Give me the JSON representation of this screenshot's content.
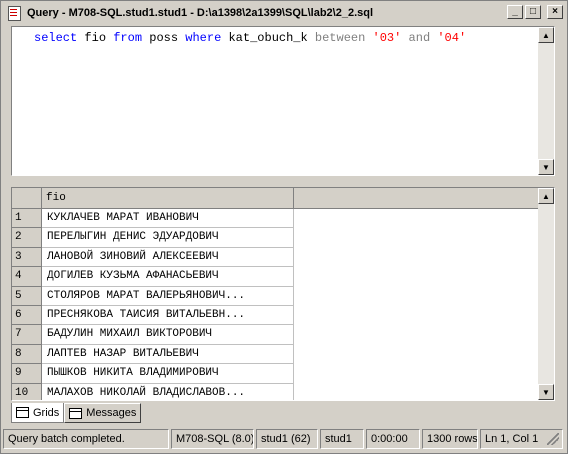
{
  "window": {
    "title": "Query - M708-SQL.stud1.stud1 - D:\\a1398\\2a1399\\SQL\\lab2\\2_2.sql",
    "minimize_label": "_",
    "maximize_label": "□",
    "close_label": "×"
  },
  "editor": {
    "tokens": [
      {
        "text": "select",
        "cls": "kw"
      },
      {
        "text": " fio ",
        "cls": ""
      },
      {
        "text": "from",
        "cls": "kw"
      },
      {
        "text": " poss ",
        "cls": ""
      },
      {
        "text": "where",
        "cls": "kw"
      },
      {
        "text": " kat_obuch_k ",
        "cls": ""
      },
      {
        "text": "between",
        "cls": "gr"
      },
      {
        "text": " ",
        "cls": ""
      },
      {
        "text": "'03'",
        "cls": "str"
      },
      {
        "text": " ",
        "cls": ""
      },
      {
        "text": "and",
        "cls": "gr"
      },
      {
        "text": " ",
        "cls": ""
      },
      {
        "text": "'04'",
        "cls": "str"
      }
    ]
  },
  "grid": {
    "column": "fio",
    "rows": [
      {
        "n": "1",
        "fio": "КУКЛАЧЕВ МАРАТ ИВАНОВИЧ"
      },
      {
        "n": "2",
        "fio": "ПЕРЕЛЫГИН ДЕНИС ЭДУАРДОВИЧ"
      },
      {
        "n": "3",
        "fio": "ЛАНОВОЙ ЗИНОВИЙ АЛЕКСЕЕВИЧ"
      },
      {
        "n": "4",
        "fio": "ДОГИЛЕВ КУЗЬМА АФАНАСЬЕВИЧ"
      },
      {
        "n": "5",
        "fio": "СТОЛЯРОВ МАРАТ ВАЛЕРЬЯНОВИЧ..."
      },
      {
        "n": "6",
        "fio": "ПРЕСНЯКОВА ТАИСИЯ ВИТАЛЬЕВН..."
      },
      {
        "n": "7",
        "fio": "БАДУЛИН МИХАИЛ ВИКТОРОВИЧ"
      },
      {
        "n": "8",
        "fio": "ЛАПТЕВ НАЗАР ВИТАЛЬЕВИЧ"
      },
      {
        "n": "9",
        "fio": "ПЫШКОВ НИКИТА ВЛАДИМИРОВИЧ"
      },
      {
        "n": "10",
        "fio": "МАЛАХОВ НИКОЛАЙ ВЛАДИСЛАВОВ..."
      }
    ]
  },
  "tabs": [
    {
      "label": "Grids",
      "active": true
    },
    {
      "label": "Messages",
      "active": false
    }
  ],
  "status": {
    "message": "Query batch completed.",
    "server": "M708-SQL (8.0)",
    "user": "stud1 (62)",
    "database": "stud1",
    "elapsed": "0:00:00",
    "rows": "1300 rows",
    "position": "Ln 1, Col 1"
  },
  "icons": {
    "scroll_up": "▲",
    "scroll_down": "▼"
  }
}
